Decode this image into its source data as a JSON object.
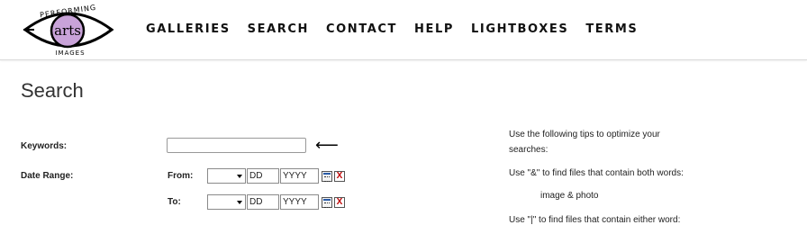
{
  "logo": {
    "top_text": "PERFORMING",
    "center_text": "arts",
    "bottom_text": "IMAGES"
  },
  "nav": {
    "items": [
      "GALLERIES",
      "SEARCH",
      "CONTACT",
      "HELP",
      "LIGHTBOXES",
      "TERMS"
    ]
  },
  "page": {
    "title": "Search"
  },
  "form": {
    "keywords_label": "Keywords:",
    "keywords_value": "",
    "arrow": "⟵",
    "date_range_label": "Date Range:",
    "from_label": "From:",
    "to_label": "To:",
    "from": {
      "month": "",
      "day": "DD",
      "year": "YYYY"
    },
    "to": {
      "month": "",
      "day": "DD",
      "year": "YYYY"
    },
    "clear_glyph": "X"
  },
  "tips": {
    "intro_line1": "Use the following tips to optimize your",
    "intro_line2": "searches:",
    "and_tip": "Use \"&\" to find files that contain both words:",
    "and_example": "image & photo",
    "or_tip_partial": "Use \"|\" to find files that contain either word:"
  },
  "colors": {
    "logo_iris": "#c9a3d9",
    "clear_x": "#c00000",
    "calendar_bar": "#2a5ca8"
  }
}
